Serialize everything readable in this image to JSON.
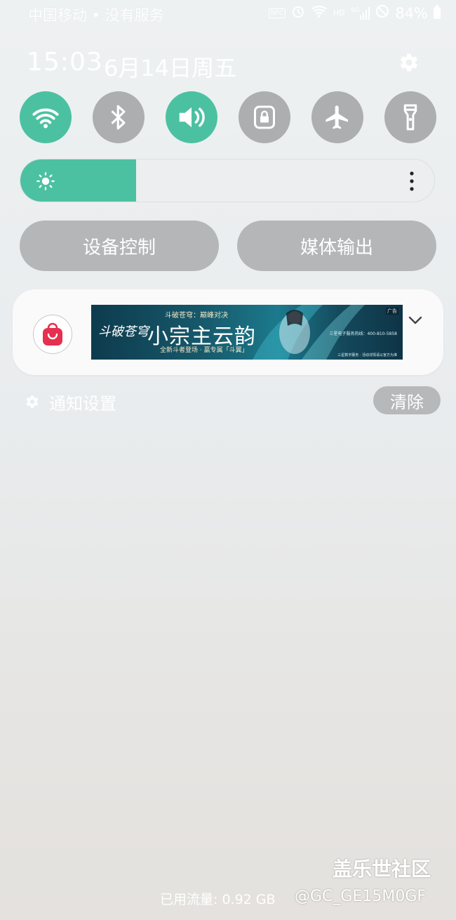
{
  "status_bar": {
    "carrier": "中国移动 • 没有服务",
    "nfc": "NFC",
    "network": "HD",
    "cellular": "5G",
    "battery": "84%",
    "icons": [
      "nfc-icon",
      "alarm-icon",
      "wifi-icon",
      "hd-icon",
      "signal-5g-icon",
      "dnd-icon",
      "battery-icon"
    ]
  },
  "header": {
    "time": "15:03",
    "date": "6月14日周五",
    "settings_icon": "gear-icon"
  },
  "quick_settings": {
    "toggles": [
      {
        "name": "wifi",
        "icon": "wifi-icon",
        "on": true
      },
      {
        "name": "bluetooth",
        "icon": "bluetooth-icon",
        "on": false
      },
      {
        "name": "sound",
        "icon": "speaker-icon",
        "on": true
      },
      {
        "name": "rotation-lock",
        "icon": "lock-icon",
        "on": false
      },
      {
        "name": "airplane-mode",
        "icon": "airplane-icon",
        "on": false
      },
      {
        "name": "flashlight",
        "icon": "flashlight-icon",
        "on": false
      }
    ],
    "brightness": {
      "level": 0.28
    }
  },
  "actions": {
    "device_control": "设备控制",
    "media_output": "媒体输出"
  },
  "notification": {
    "app_icon": "shopping-bag-icon",
    "ad": {
      "logo": "斗破苍穹",
      "tagline": "斗破苍穹：巅峰对决",
      "title": "小宗主云韵",
      "subtitle": "全新斗者登场 · 赢专属「斗翼」",
      "tag": "广告",
      "hotline": "三星电子服务热线：400-810-5858",
      "fine_print": "三星数字服务 · 活动详情请以官方为准"
    }
  },
  "notification_settings": {
    "label": "通知设置",
    "clear": "清除"
  },
  "footer": {
    "data_usage": "已用流量: 0.92 GB",
    "watermark_site": "盖乐世社区",
    "watermark_user": "@GC_GE15M0GF"
  },
  "colors": {
    "accent": "#4cc1a2",
    "inactive": "#adaeb0",
    "card": "#fafafa"
  }
}
